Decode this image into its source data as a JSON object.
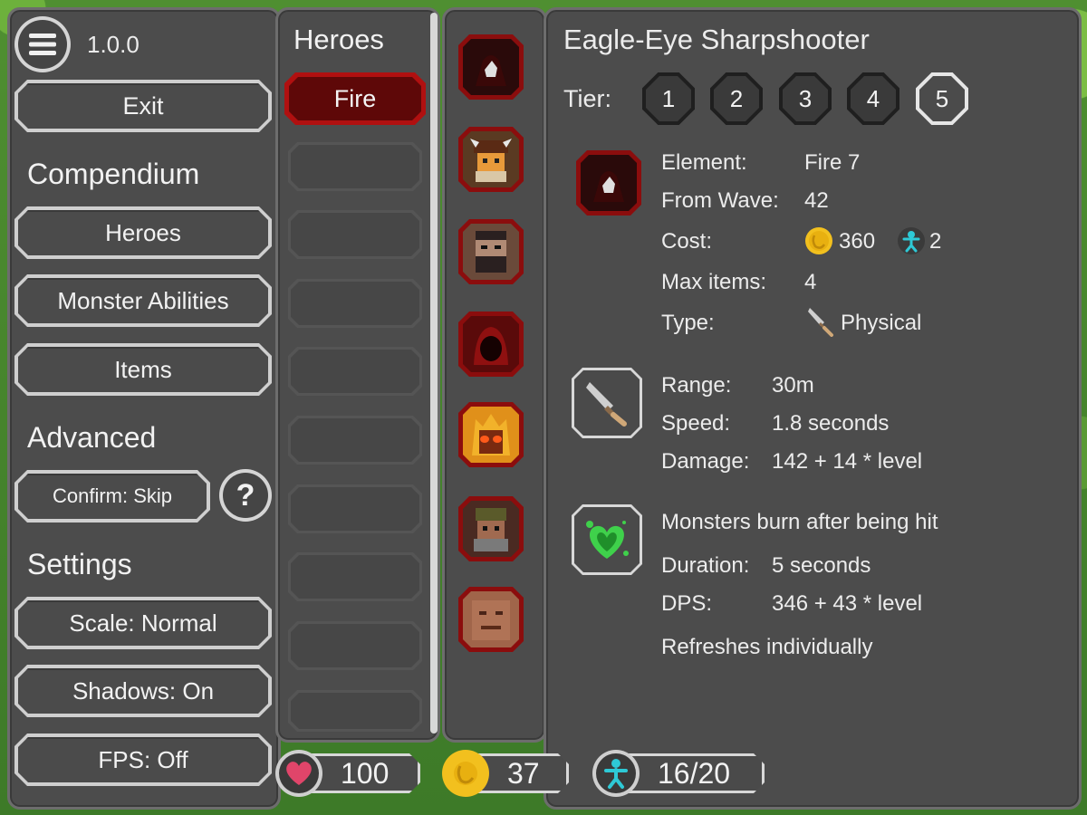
{
  "menu": {
    "version": "1.0.0",
    "exit_label": "Exit",
    "compendium_title": "Compendium",
    "heroes_label": "Heroes",
    "monster_abilities_label": "Monster Abilities",
    "items_label": "Items",
    "advanced_title": "Advanced",
    "confirm_label": "Confirm: Skip",
    "help_label": "?",
    "settings_title": "Settings",
    "scale_label": "Scale: Normal",
    "shadows_label": "Shadows: On",
    "fps_label": "FPS: Off"
  },
  "heroes_list": {
    "title": "Heroes",
    "selected_label": "Fire"
  },
  "detail": {
    "name": "Eagle-Eye Sharpshooter",
    "tier_label": "Tier:",
    "tiers": [
      "1",
      "2",
      "3",
      "4",
      "5"
    ],
    "selected_tier": "5",
    "element_label": "Element:",
    "element_value": "Fire 7",
    "wave_label": "From Wave:",
    "wave_value": "42",
    "cost_label": "Cost:",
    "cost_gold": "360",
    "cost_pop": "2",
    "max_items_label": "Max items:",
    "max_items_value": "4",
    "type_label": "Type:",
    "type_value": "Physical",
    "range_label": "Range:",
    "range_value": "30m",
    "speed_label": "Speed:",
    "speed_value": "1.8 seconds",
    "damage_label": "Damage:",
    "damage_value": "142 + 14 * level",
    "ability_text": "Monsters burn after being hit",
    "duration_label": "Duration:",
    "duration_value": "5 seconds",
    "dps_label": "DPS:",
    "dps_value": "346 + 43 * level",
    "refresh_text": "Refreshes individually"
  },
  "status": {
    "lives": "100",
    "gold": "37",
    "population": "16/20"
  },
  "colors": {
    "panel": "#4c4c4c",
    "fire": "#8b0d0d",
    "gold": "#f2c01e",
    "pop": "#2ec9d6",
    "heart": "#e0456a",
    "poison": "#3fd14b"
  }
}
